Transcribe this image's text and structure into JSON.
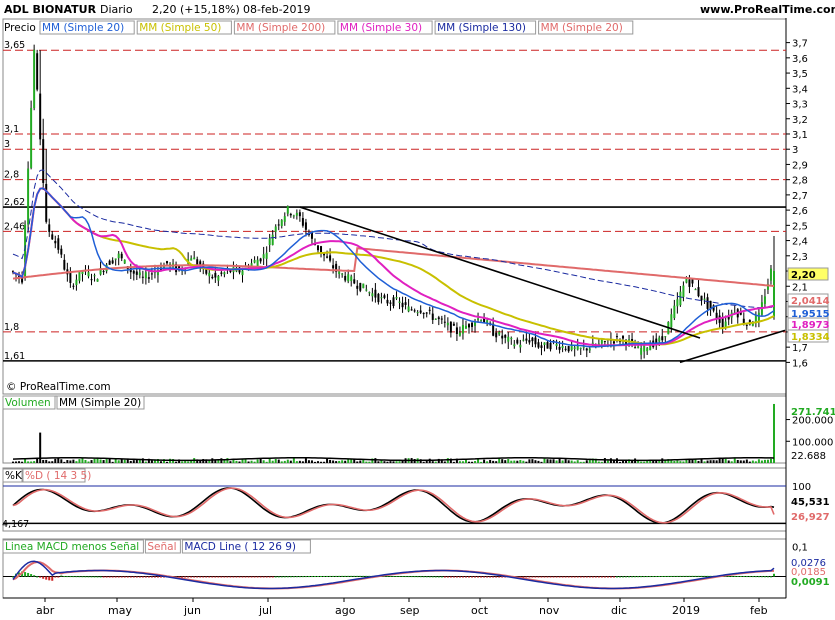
{
  "header": {
    "ticker": "ADL BIONATUR",
    "period": "Diario",
    "price_change": "2,20 (+15,18%)",
    "date": "08-feb-2019",
    "brand": "www.ProRealTime.com"
  },
  "price_panel": {
    "label": "Precio",
    "watermark": "© ProRealTime.com",
    "legend": [
      {
        "name": "MM (Simple 20)",
        "color": "#1f5fd6"
      },
      {
        "name": "MM (Simple 50)",
        "color": "#c8c000"
      },
      {
        "name": "MM (Simple 200)",
        "color": "#e06a6a"
      },
      {
        "name": "MM (Simple 30)",
        "color": "#e020c0"
      },
      {
        "name": "MM (Simple 130)",
        "color": "#1a2aa0"
      },
      {
        "name": "MM (Simple 20)",
        "color": "#e06a6a"
      }
    ],
    "left_levels": [
      "3,65",
      "3,1",
      "3",
      "2,8",
      "2,62",
      "2,46",
      "1,8",
      "1,61"
    ],
    "right_ticks": [
      "3,7",
      "3,6",
      "3,5",
      "3,4",
      "3,3",
      "3,2",
      "3,1",
      "3",
      "2,9",
      "2,8",
      "2,7",
      "2,6",
      "2,5",
      "2,4",
      "2,3",
      "2,2",
      "2,1",
      "2",
      "1,9",
      "1,8",
      "1,7",
      "1,6"
    ],
    "value_tags": [
      {
        "text": "2,20",
        "color": "#000000",
        "bg": "#ffff66"
      },
      {
        "text": "2,0414",
        "color": "#e06a6a",
        "bg": "#ffffff"
      },
      {
        "text": "1,9515",
        "color": "#1f5fd6",
        "bg": "#ffffff"
      },
      {
        "text": "1,8973",
        "color": "#e020c0",
        "bg": "#ffffff"
      },
      {
        "text": "1,8334",
        "color": "#c8c000",
        "bg": "#ffffff"
      }
    ]
  },
  "volume_panel": {
    "label": "Volumen",
    "legend": "MM (Simple 20)",
    "ticks": [
      "200.000",
      "100.000"
    ],
    "value_tags": [
      {
        "text": "271.741",
        "color": "#22aa22"
      },
      {
        "text": "22.688",
        "color": "#000000"
      }
    ]
  },
  "stoch_panel": {
    "label_k": "%K",
    "label_d": "%D ( 14 3 5)",
    "left_level": "4,167",
    "ticks": [
      "100"
    ],
    "value_tags": [
      {
        "text": "45,531",
        "color": "#000000"
      },
      {
        "text": "26,927",
        "color": "#e06a6a"
      }
    ]
  },
  "macd_panel": {
    "label_hist": "Linea MACD menos Señal",
    "label_signal": "Señal",
    "label_line": "MACD Line ( 12 26 9)",
    "ticks": [
      "0,1"
    ],
    "value_tags": [
      {
        "text": "0,0276",
        "color": "#1a2aa0"
      },
      {
        "text": "0,0185",
        "color": "#e06a6a"
      },
      {
        "text": "0,0091",
        "color": "#22aa22"
      }
    ]
  },
  "x_axis": [
    "abr",
    "may",
    "jun",
    "jul",
    "ago",
    "sep",
    "oct",
    "nov",
    "dic",
    "2019",
    "feb"
  ],
  "chart_data": {
    "type": "candlestick",
    "x_range": [
      "mar 2018",
      "feb 2019"
    ],
    "ylim": [
      1.55,
      3.75
    ],
    "price_path": [
      [
        2.2,
        2.15,
        3.65,
        2.5,
        2.35,
        2.1,
        2.2,
        2.15,
        2.25,
        2.3,
        2.2,
        2.15,
        2.2,
        2.25,
        2.2,
        2.3,
        2.2,
        2.15,
        2.2,
        2.2,
        2.25,
        2.3,
        2.5,
        2.6,
        2.55,
        2.4,
        2.3,
        2.2,
        2.15,
        2.1,
        2.05,
        2.0,
        2.0,
        1.95,
        1.95,
        1.9,
        1.85,
        1.8,
        1.85,
        1.9,
        1.8,
        1.75,
        1.72,
        1.75,
        1.7,
        1.72,
        1.7,
        1.68,
        1.7,
        1.72,
        1.75,
        1.75,
        1.68,
        1.72,
        1.75,
        1.95,
        2.15,
        2.05,
        1.95,
        1.85,
        1.95,
        1.85,
        1.9,
        2.2
      ]
    ],
    "moving_averages": {
      "sma200_end": 2.0414,
      "sma20_end": 1.9515,
      "sma30_end": 1.8973,
      "sma50_end": 1.8334,
      "last_close": 2.2
    },
    "volume_end": 271741,
    "volume_sma20_end": 22688,
    "stoch_k_end": 45.531,
    "stoch_d_end": 26.927,
    "macd_line_end": 0.0276,
    "macd_signal_end": 0.0185,
    "macd_hist_end": 0.0091
  }
}
